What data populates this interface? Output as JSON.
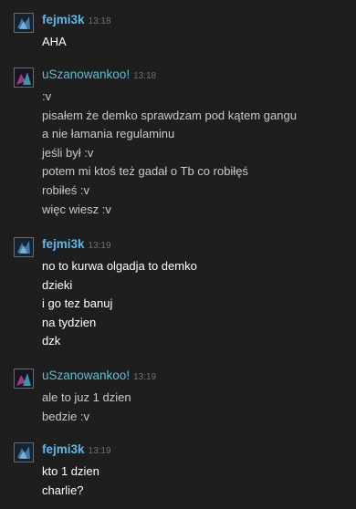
{
  "messages": [
    {
      "author": "fejmi3k",
      "time": "13:18",
      "lines": [
        "AHA"
      ]
    },
    {
      "author": "uSzanowankoo!",
      "time": "13:18",
      "lines": [
        ":v",
        "pisałem że demko sprawdzam pod kątem gangu",
        "a nie łamania regulaminu",
        "jeśli był :v",
        "potem mi ktoś też gadał o Tb co robiłęś",
        "robiłeś :v",
        "więc wiesz :v"
      ]
    },
    {
      "author": "fejmi3k",
      "time": "13:19",
      "lines": [
        "no to kurwa olgadja to demko",
        "dzieki",
        "i go tez banuj",
        "na tydzien",
        "dzk"
      ]
    },
    {
      "author": "uSzanowankoo!",
      "time": "13:19",
      "lines": [
        "ale to juz 1 dzien",
        "bedzie :v"
      ]
    },
    {
      "author": "fejmi3k",
      "time": "13:19",
      "lines": [
        "kto 1 dzien",
        "charlie?"
      ]
    }
  ],
  "colors": {
    "background": "#1e1e1e",
    "author_fejmi3k": "#5fb8e8",
    "author_uszanowankoo": "#5bbfd6",
    "timestamp": "#6f6f6f",
    "text_light": "#c9c9c9",
    "text_bright": "#ffffff"
  },
  "icons": {
    "avatar_fejmi3k": "avatar-icon",
    "avatar_uszanowankoo": "avatar-icon"
  }
}
